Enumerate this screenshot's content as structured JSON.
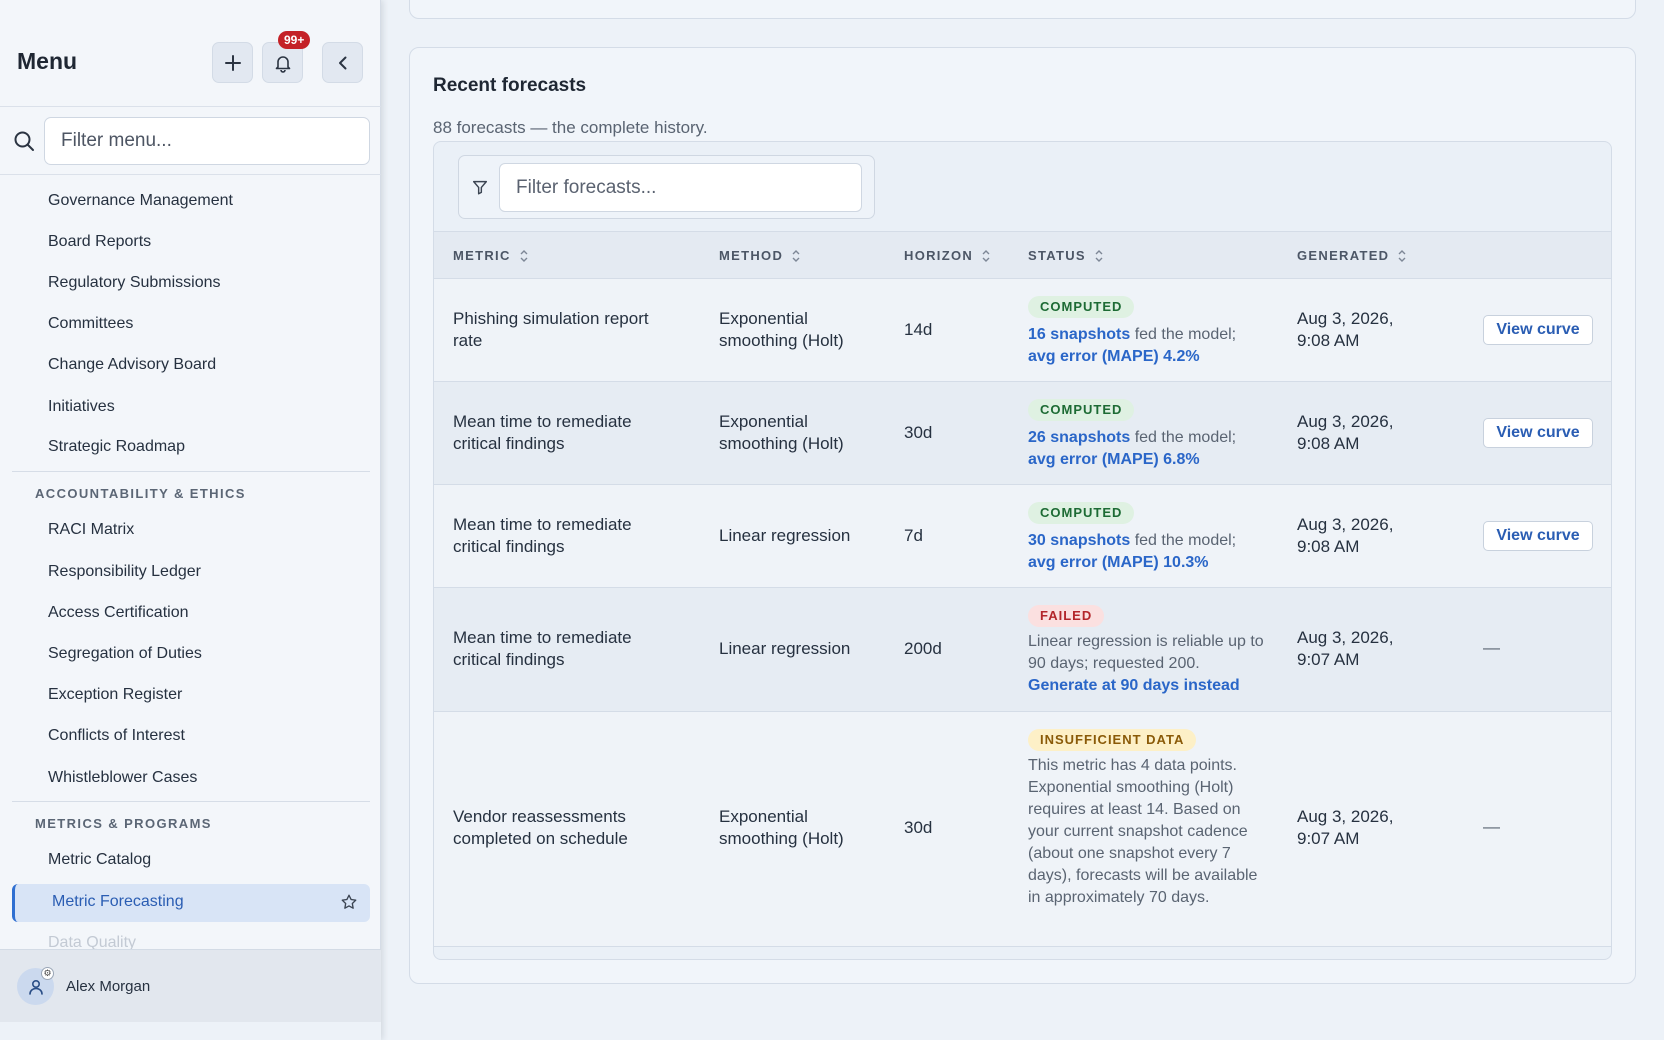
{
  "sidebar": {
    "title": "Menu",
    "notification_count": "99+",
    "search_placeholder": "Filter menu...",
    "items_top": [
      {
        "label": "Governance Management"
      },
      {
        "label": "Board Reports"
      },
      {
        "label": "Regulatory Submissions"
      },
      {
        "label": "Committees"
      },
      {
        "label": "Change Advisory Board"
      },
      {
        "label": "Initiatives"
      },
      {
        "label": "Strategic Roadmap"
      }
    ],
    "section_accountability": "ACCOUNTABILITY & ETHICS",
    "items_accountability": [
      {
        "label": "RACI Matrix"
      },
      {
        "label": "Responsibility Ledger"
      },
      {
        "label": "Access Certification"
      },
      {
        "label": "Segregation of Duties"
      },
      {
        "label": "Exception Register"
      },
      {
        "label": "Conflicts of Interest"
      },
      {
        "label": "Whistleblower Cases"
      }
    ],
    "section_metrics": "METRICS & PROGRAMS",
    "items_metrics": [
      {
        "label": "Metric Catalog"
      },
      {
        "label": "Metric Forecasting",
        "active": true
      },
      {
        "label": "Data Quality"
      }
    ],
    "user_name": "Alex Morgan"
  },
  "main": {
    "title": "Recent forecasts",
    "subtitle": "88 forecasts — the complete history.",
    "filter_placeholder": "Filter forecasts...",
    "columns": [
      "METRIC",
      "METHOD",
      "HORIZON",
      "STATUS",
      "GENERATED"
    ],
    "rows": [
      {
        "metric": "Phishing simulation report rate",
        "method": "Exponential smoothing (Holt)",
        "horizon": "14d",
        "status": "COMPUTED",
        "status_link1": "16 snapshots",
        "status_text": " fed the model;",
        "status_link2": "avg error (MAPE) 4.2%",
        "generated": "Aug 3, 2026, 9:08 AM",
        "action": "View curve"
      },
      {
        "metric": "Mean time to remediate critical findings",
        "method": "Exponential smoothing (Holt)",
        "horizon": "30d",
        "status": "COMPUTED",
        "status_link1": "26 snapshots",
        "status_text": " fed the model;",
        "status_link2": "avg error (MAPE) 6.8%",
        "generated": "Aug 3, 2026, 9:08 AM",
        "action": "View curve"
      },
      {
        "metric": "Mean time to remediate critical findings",
        "method": "Linear regression",
        "horizon": "7d",
        "status": "COMPUTED",
        "status_link1": "30 snapshots",
        "status_text": " fed the model;",
        "status_link2": "avg error (MAPE) 10.3%",
        "generated": "Aug 3, 2026, 9:08 AM",
        "action": "View curve"
      },
      {
        "metric": "Mean time to remediate critical findings",
        "method": "Linear regression",
        "horizon": "200d",
        "status": "FAILED",
        "status_text": "Linear regression is reliable up to 90 days; requested 200.",
        "status_link": "Generate at 90 days instead",
        "generated": "Aug 3, 2026, 9:07 AM",
        "action": "—"
      },
      {
        "metric": "Vendor reassessments completed on schedule",
        "method": "Exponential smoothing (Holt)",
        "horizon": "30d",
        "status": "INSUFFICIENT DATA",
        "status_text": "This metric has 4 data points. Exponential smoothing (Holt) requires at least 14. Based on your current snapshot cadence (about one snapshot every 7 days), forecasts will be available in approximately 70 days.",
        "generated": "Aug 3, 2026, 9:07 AM",
        "action": "—"
      }
    ]
  },
  "colors": {
    "accent": "#2a66c8",
    "computed": "#1d6b34",
    "failed": "#b3262b",
    "insufficient": "#8a5a08"
  }
}
